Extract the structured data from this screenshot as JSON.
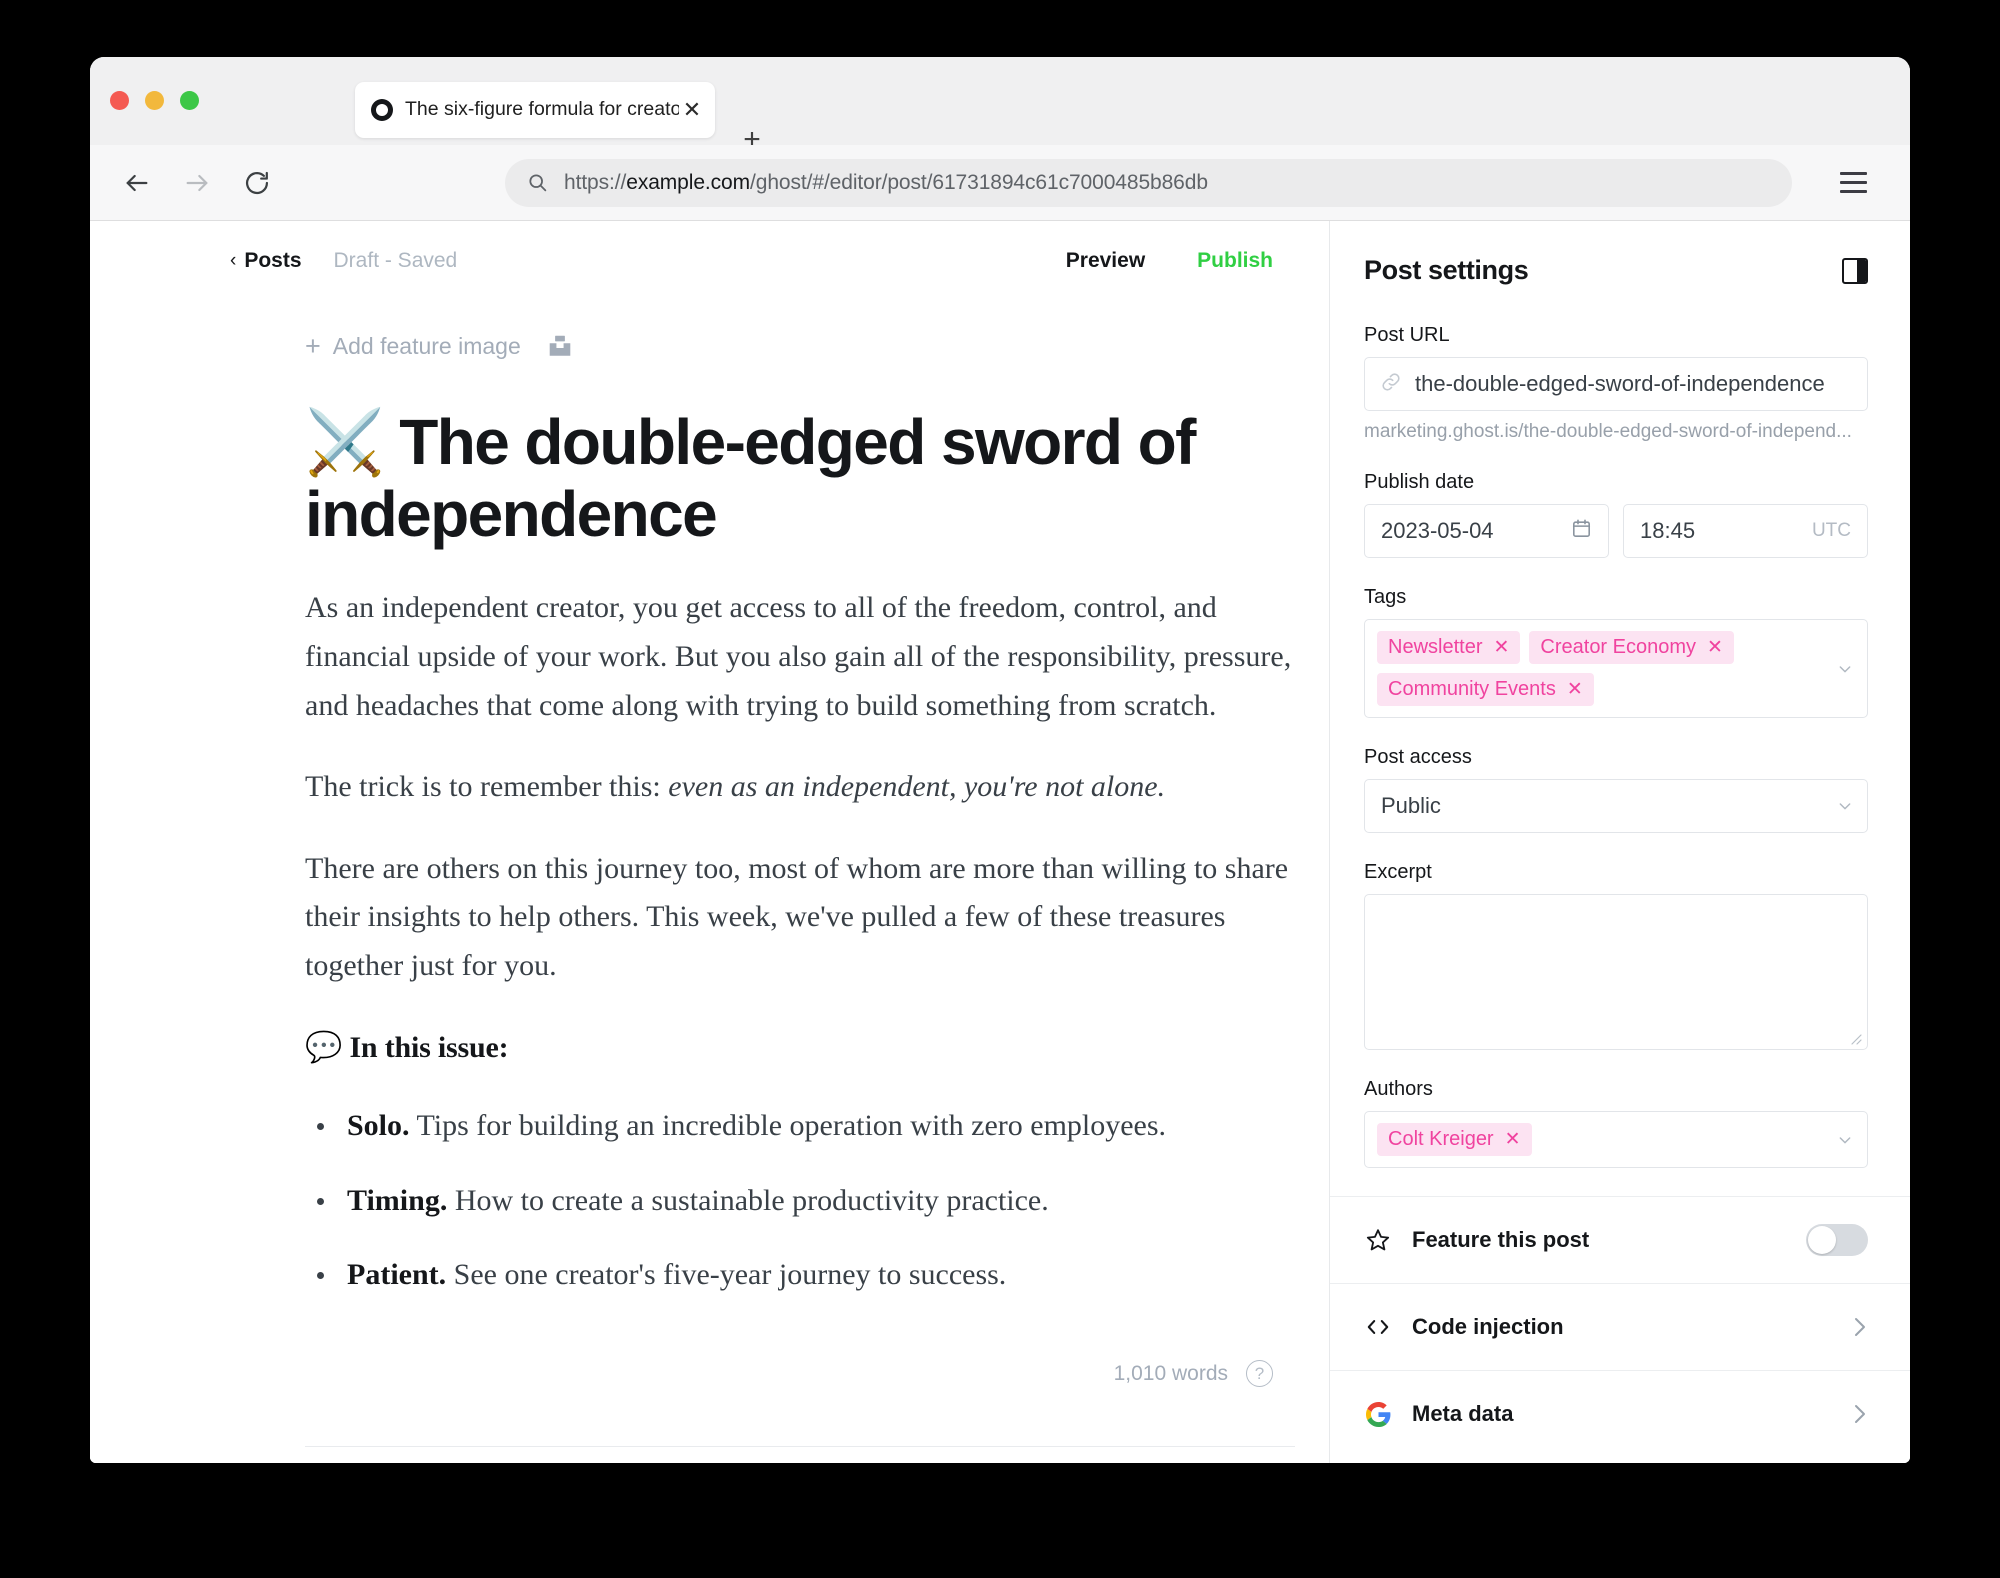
{
  "browser": {
    "tab": {
      "title": "The six-figure formula for creato",
      "favicon": "ghost-logo-icon",
      "close_label": "✕"
    },
    "new_tab_label": "+",
    "omnibox": {
      "url_prefix": "https://",
      "url_host": "example.com",
      "url_path": "/ghost/#/editor/post/61731894c61c7000485b86db",
      "url_full": "https://example.com/ghost/#/editor/post/61731894c61c7000485b86db"
    },
    "controls": {
      "back": "back-arrow-icon",
      "forward": "forward-arrow-icon",
      "reload": "reload-icon",
      "menu": "hamburger-menu-icon"
    }
  },
  "editor": {
    "back_label": "Posts",
    "back_chevron": "‹",
    "status": "Draft - Saved",
    "preview_label": "Preview",
    "publish_label": "Publish",
    "publish_color": "#30cf43",
    "feature_image_label": "Add feature image",
    "feature_image_plus": "+",
    "title": "⚔️ The double-edged sword of independence",
    "paragraphs": [
      "As an independent creator, you get access to all of the freedom, control, and financial upside of your work. But you also gain all of the responsibility, pressure, and headaches that come along with trying to build something from scratch.",
      "The trick is to remember this: ",
      "There are others on this journey too, most of whom are more than willing to share their insights to help others. This week, we've pulled a few of these treasures together just for you."
    ],
    "italic_clause": "even as an independent, you're not alone.",
    "section_heading": "💬 In this issue:",
    "bullets": [
      {
        "lead": "Solo.",
        "text": " Tips for building an incredible operation with zero employees."
      },
      {
        "lead": "Timing.",
        "text": " How to create a sustainable productivity practice."
      },
      {
        "lead": "Patient.",
        "text": " See one creator's five-year journey to success."
      }
    ],
    "word_count": "1,010 words",
    "help_glyph": "?"
  },
  "settings": {
    "title": "Post settings",
    "panel_toggle": "sidebar-toggle-icon",
    "post_url": {
      "label": "Post URL",
      "value": "the-double-edged-sword-of-independence",
      "hint": "marketing.ghost.is/the-double-edged-sword-of-independ..."
    },
    "publish_date": {
      "label": "Publish date",
      "date": "2023-05-04",
      "time": "18:45",
      "timezone": "UTC"
    },
    "tags": {
      "label": "Tags",
      "items": [
        "Newsletter",
        "Creator Economy",
        "Community Events"
      ],
      "remove_glyph": "✕",
      "chip_bg": "#fce3f2",
      "chip_fg": "#f0439f"
    },
    "post_access": {
      "label": "Post access",
      "value": "Public"
    },
    "excerpt": {
      "label": "Excerpt",
      "value": ""
    },
    "authors": {
      "label": "Authors",
      "items": [
        "Colt Kreiger"
      ],
      "remove_glyph": "✕"
    },
    "rows": [
      {
        "label": "Feature this post",
        "icon": "star-icon",
        "control": "toggle",
        "toggle_on": false
      },
      {
        "label": "Code injection",
        "icon": "code-brackets-icon",
        "control": "chevron"
      },
      {
        "label": "Meta data",
        "icon": "google-g-icon",
        "control": "chevron"
      }
    ]
  }
}
